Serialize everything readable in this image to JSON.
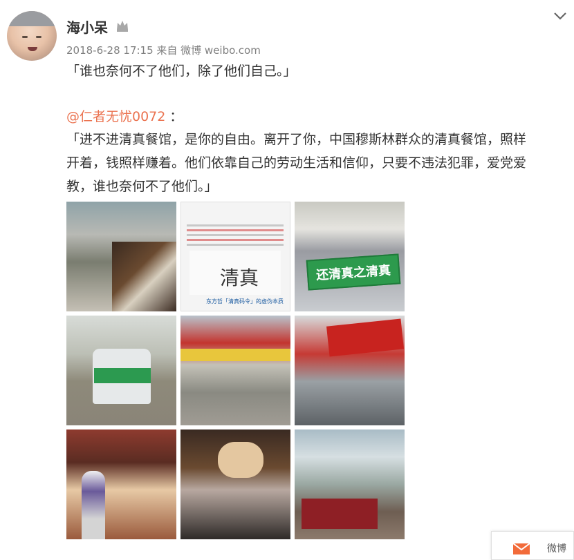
{
  "post": {
    "username": "海小呆",
    "meta": "2018-6-28 17:15 来自 微博 weibo.com",
    "text": "「谁也奈何不了他们，除了他们自己。」",
    "mention": "@仁者无忧0072",
    "mention_colon": "：",
    "quoted_line1": "「进不进清真餐馆，是你的自由。离开了你，中国穆斯林群众的清真餐馆，照样",
    "quoted_line2": "开着，钱照样赚着。他们依靠自己的劳动生活和信仰，只要不违法犯罪，爱党爱",
    "quoted_line3": "教，谁也奈何不了他们。」"
  },
  "photos": {
    "p2_big": "清真",
    "p2_caption": "东方哲「清真码令」的虚伪本质",
    "p3_banner": "还清真之清真"
  },
  "float_bar": {
    "label": "微博"
  },
  "colors": {
    "mention": "#eb7350",
    "text": "#333333",
    "meta": "#808080"
  }
}
